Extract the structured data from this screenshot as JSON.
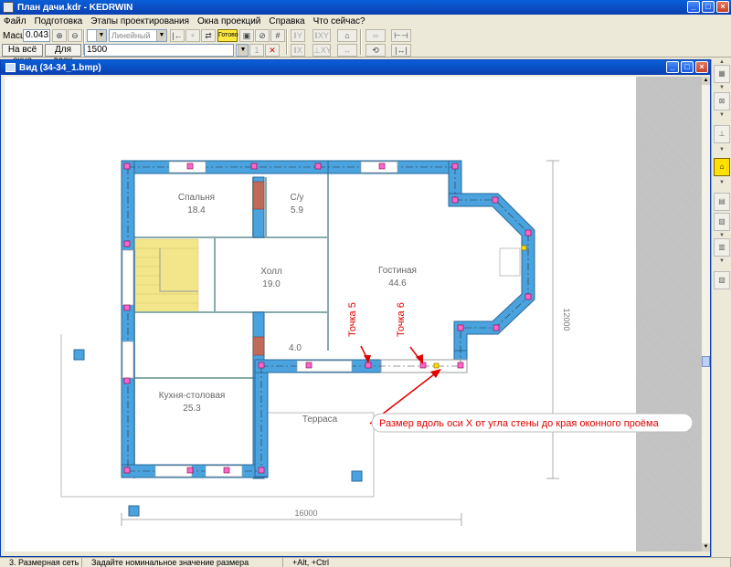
{
  "window": {
    "title": "План дачи.kdr - KEDRWIN"
  },
  "menu": [
    "Файл",
    "Подготовка",
    "Этапы проектирования",
    "Окна проекций",
    "Справка",
    "Что сейчас?"
  ],
  "toolbar": {
    "scale_label": "Масшт",
    "scale_value": "0.043",
    "fit_window_label": "На всё окно",
    "fit_all_label": "Для всех",
    "line_type": "Линейный",
    "ready_label": "Готово",
    "dimension_value": "1500"
  },
  "view": {
    "title": "Вид (34-34_1.bmp)"
  },
  "plan": {
    "rooms": [
      {
        "name": "Гостиная",
        "area": "44.6"
      },
      {
        "name": "Холл",
        "area": "19.0"
      },
      {
        "name": "Спальня",
        "area": "18.4"
      },
      {
        "name": "С/у",
        "area": "5.9"
      },
      {
        "name": "Кухня-столовая",
        "area": "25.3"
      },
      {
        "name": "",
        "area": "4.0"
      },
      {
        "name": "Терраса",
        "area": ""
      }
    ],
    "dims": {
      "horizontal": "16000",
      "vertical": "12000"
    },
    "labels": {
      "point5": "Точка 5",
      "point6": "Точка 6",
      "note": "Размер вдоль оси X от угла стены до края оконного проёма"
    }
  },
  "status": {
    "mode": "3. Размерная сеть",
    "hint": "Задайте номинальное значение размера",
    "keys": "+Alt, +Ctrl"
  },
  "colors": {
    "wall": "#4aa3df",
    "accent_red": "#e00000",
    "stair": "#f2e58a"
  }
}
